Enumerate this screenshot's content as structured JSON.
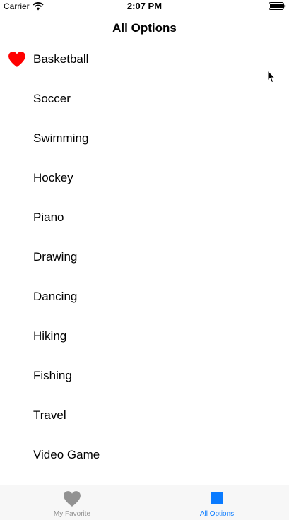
{
  "status_bar": {
    "carrier": "Carrier",
    "time": "2:07 PM"
  },
  "nav": {
    "title": "All Options"
  },
  "options": [
    {
      "label": "Basketball",
      "favorite": true
    },
    {
      "label": "Soccer",
      "favorite": false
    },
    {
      "label": "Swimming",
      "favorite": false
    },
    {
      "label": "Hockey",
      "favorite": false
    },
    {
      "label": "Piano",
      "favorite": false
    },
    {
      "label": "Drawing",
      "favorite": false
    },
    {
      "label": "Dancing",
      "favorite": false
    },
    {
      "label": "Hiking",
      "favorite": false
    },
    {
      "label": "Fishing",
      "favorite": false
    },
    {
      "label": "Travel",
      "favorite": false
    },
    {
      "label": "Video Game",
      "favorite": false
    }
  ],
  "tab_bar": {
    "tabs": [
      {
        "label": "My Favorite",
        "icon": "heart-icon",
        "selected": false
      },
      {
        "label": "All Options",
        "icon": "square-icon",
        "selected": true
      }
    ]
  },
  "colors": {
    "accent": "#0a7bff",
    "favorite_heart": "#ff0000",
    "inactive_tab": "#929292"
  }
}
